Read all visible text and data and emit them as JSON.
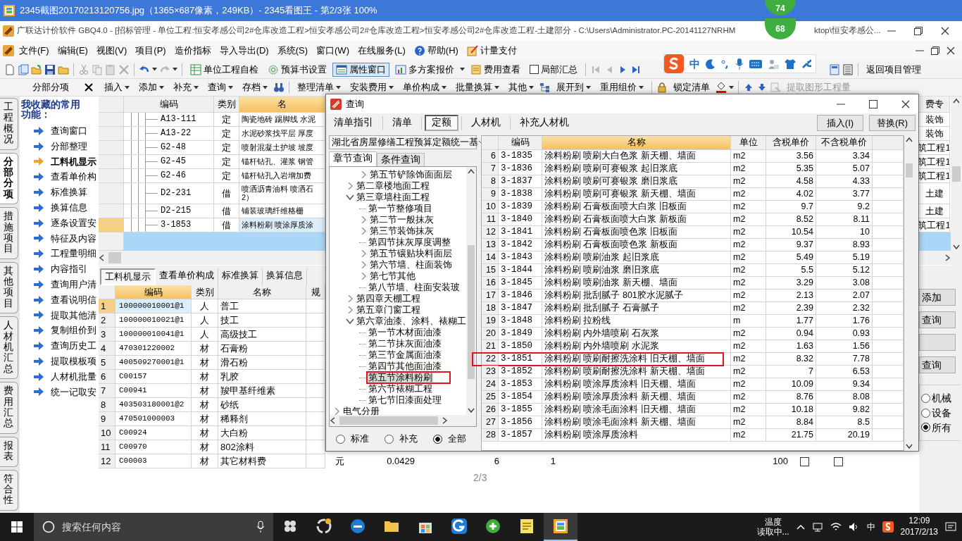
{
  "viewer": {
    "title": "2345截图20170213120756.jpg（1365×687像素，249KB）- 2345看图王 - 第2/3张 100%",
    "page_indicator": "2/3"
  },
  "speed_badges": [
    "74",
    "68"
  ],
  "app": {
    "title_start": "广联达计价软件 GBQ4.0 - [招标管理 - 单位工程:恒安孝感公司2#仓库改造工程>恒安孝感公司2#仓库改造工程>恒安孝感公司2#仓库改造工程-土建部分 - C:\\Users\\Administrator.PC-20141127NRHM",
    "title_end": "ktop\\恒安孝感公..."
  },
  "menu": [
    "文件(F)",
    "编辑(E)",
    "视图(V)",
    "项目(P)",
    "造价指标",
    "导入导出(D)",
    "系统(S)",
    "窗口(W)",
    "在线服务(L)",
    "帮助(H)",
    "计量支付"
  ],
  "toolbar1": [
    {
      "label": "单位工程自检",
      "pressed": false
    },
    {
      "label": "预算书设置",
      "pressed": false
    },
    {
      "label": "属性窗口",
      "pressed": true
    },
    {
      "label": "多方案报价",
      "pressed": false
    },
    {
      "label": "费用查看",
      "pressed": false
    }
  ],
  "local_summary": {
    "label": "局部汇总",
    "checked": false
  },
  "return_button": "返回项目管理",
  "ime_bar": {
    "mode": "中"
  },
  "panel_title": "分部分项",
  "toolbar2": [
    {
      "label": "插入",
      "dropdown": true,
      "disabled": false
    },
    {
      "label": "添加",
      "dropdown": true,
      "disabled": false
    },
    {
      "label": "补充",
      "dropdown": true,
      "disabled": false
    },
    {
      "label": "查询",
      "dropdown": true,
      "disabled": false
    },
    {
      "label": "存档",
      "dropdown": true,
      "disabled": false
    },
    {
      "label": "整理清单",
      "dropdown": true,
      "disabled": false
    },
    {
      "label": "安装费用",
      "dropdown": true,
      "disabled": false
    },
    {
      "label": "单价构成",
      "dropdown": true,
      "disabled": false
    },
    {
      "label": "批量换算",
      "dropdown": true,
      "disabled": false
    },
    {
      "label": "其他",
      "dropdown": true,
      "disabled": false
    },
    {
      "label": "展开到",
      "dropdown": true,
      "disabled": false
    },
    {
      "label": "重用组价",
      "dropdown": true,
      "disabled": false
    },
    {
      "label": "锁定清单",
      "dropdown": false,
      "disabled": false
    },
    {
      "label": "提取图形工程量",
      "dropdown": false,
      "disabled": true
    }
  ],
  "side_tabs": [
    {
      "label": "工程概况",
      "selected": false
    },
    {
      "label": "分部分项",
      "selected": true
    },
    {
      "label": "措施项目",
      "selected": false
    },
    {
      "label": "其他项目",
      "selected": false
    },
    {
      "label": "人材机汇总",
      "selected": false
    },
    {
      "label": "费用汇总",
      "selected": false
    },
    {
      "label": "报表",
      "selected": false
    },
    {
      "label": "符合性",
      "selected": false
    }
  ],
  "favorites": {
    "title": "我收藏的常用功能：",
    "items": [
      {
        "label": "查询窗口",
        "selected": false
      },
      {
        "label": "分部整理",
        "selected": false
      },
      {
        "label": "工料机显示",
        "selected": true
      },
      {
        "label": "查看单价构",
        "selected": false
      },
      {
        "label": "标准换算",
        "selected": false
      },
      {
        "label": "换算信息",
        "selected": false
      },
      {
        "label": "逐条设置安",
        "selected": false
      },
      {
        "label": "特征及内容",
        "selected": false
      },
      {
        "label": "工程量明细",
        "selected": false
      },
      {
        "label": "内容指引",
        "selected": false
      },
      {
        "label": "查询用户清",
        "selected": false
      },
      {
        "label": "查看说明信",
        "selected": false
      },
      {
        "label": "提取其他清",
        "selected": false
      },
      {
        "label": "复制组价到",
        "selected": false
      },
      {
        "label": "查询历史工",
        "selected": false
      },
      {
        "label": "提取模板项",
        "selected": false
      },
      {
        "label": "人材机批量",
        "selected": false
      },
      {
        "label": "统一记取安",
        "selected": false
      }
    ]
  },
  "upper_grid": {
    "columns": [
      "编码",
      "类别",
      "名"
    ],
    "slice_column": "费专",
    "rows": [
      {
        "code": "A13-111",
        "type": "定",
        "name": "陶瓷地砖 踢脚线 水泥",
        "slice": "装饰",
        "selected": false
      },
      {
        "code": "A13-22",
        "type": "定",
        "name": "水泥砂浆找平层 厚度",
        "slice": "装饰",
        "selected": false
      },
      {
        "code": "G2-48",
        "type": "定",
        "name": "喷射混凝土护坡 坡度",
        "slice": "筑工程1",
        "selected": false
      },
      {
        "code": "G2-45",
        "type": "定",
        "name": "锚杆钻孔、灌浆 钢管",
        "slice": "筑工程1",
        "selected": false
      },
      {
        "code": "G2-46",
        "type": "定",
        "name": "锚杆钻孔入岩增加费",
        "slice": "筑工程1",
        "selected": false
      },
      {
        "code": "D2-231",
        "type": "借",
        "name": "喷洒沥青油料 喷洒石\n2）",
        "slice": "土建",
        "selected": false
      },
      {
        "code": "D2-215",
        "type": "借",
        "name": "铺装玻璃纤维格栅",
        "slice": "土建",
        "selected": false
      },
      {
        "code": "3-1853",
        "type": "借",
        "name": "涂料粉刷 喷涂厚质涂",
        "slice": "筑工程1",
        "selected": true
      }
    ]
  },
  "lower_tabs": [
    {
      "label": "工料机显示",
      "selected": true
    },
    {
      "label": "查看单价构成",
      "selected": false
    },
    {
      "label": "标准换算",
      "selected": false
    },
    {
      "label": "换算信息",
      "selected": false
    }
  ],
  "lower_grid": {
    "columns": [
      "编码",
      "类别",
      "名称",
      "规"
    ],
    "rows": [
      {
        "no": "1",
        "code": "100000010001@1",
        "type": "人",
        "name": "普工",
        "selected": true
      },
      {
        "no": "2",
        "code": "100000010021@1",
        "type": "人",
        "name": "技工",
        "selected": false
      },
      {
        "no": "3",
        "code": "100000010041@1",
        "type": "人",
        "name": "高级技工",
        "selected": false
      },
      {
        "no": "4",
        "code": "470301220002",
        "type": "材",
        "name": "石膏粉",
        "selected": false
      },
      {
        "no": "5",
        "code": "400509270001@1",
        "type": "材",
        "name": "滑石粉",
        "selected": false
      },
      {
        "no": "6",
        "code": "C00157",
        "type": "材",
        "name": "乳胶",
        "selected": false
      },
      {
        "no": "7",
        "code": "C00941",
        "type": "材",
        "name": "羧甲基纤维素",
        "selected": false
      },
      {
        "no": "8",
        "code": "403503180001@2",
        "type": "材",
        "name": "砂纸",
        "selected": false
      },
      {
        "no": "9",
        "code": "470501000003",
        "type": "材",
        "name": "稀释剂",
        "selected": false
      },
      {
        "no": "10",
        "code": "C00924",
        "type": "材",
        "name": "大白粉",
        "selected": false
      },
      {
        "no": "11",
        "code": "C00970",
        "type": "材",
        "name": "802涂料",
        "selected": false
      },
      {
        "no": "12",
        "code": "C00003",
        "type": "材",
        "name": "其它材料费",
        "selected": false,
        "tail": {
          "unit": "元",
          "values": [
            "0.0429",
            "6",
            "1",
            "100"
          ],
          "checks": [
            false,
            false
          ]
        }
      }
    ]
  },
  "side_buttons": [
    {
      "kind": "text",
      "label": "添加"
    },
    {
      "kind": "text",
      "label": "查询"
    },
    {
      "kind": "blank"
    },
    {
      "kind": "text",
      "label": "查询"
    }
  ],
  "side_radios": [
    {
      "label": "机械",
      "selected": false
    },
    {
      "label": "设备",
      "selected": false
    },
    {
      "label": "所有",
      "selected": true
    }
  ],
  "dialog": {
    "title": "查询",
    "tabs": [
      {
        "label": "清单指引",
        "selected": false
      },
      {
        "label": "清单",
        "selected": false
      },
      {
        "label": "定额",
        "selected": true
      },
      {
        "label": "人材机",
        "selected": false
      },
      {
        "label": "补充人材机",
        "selected": false
      }
    ],
    "buttons": [
      "插入(I)",
      "替换(R)"
    ],
    "library": "湖北省房屋修缮工程预算定额统一基",
    "subtabs": [
      {
        "label": "章节查询",
        "selected": true
      },
      {
        "label": "条件查询",
        "selected": false
      }
    ],
    "tree": [
      {
        "children": [
          {
            "children": [
              {
                "label": "第五节铲除饰面面层",
                "kind": "folder",
                "expanded": false,
                "selected": false,
                "marked": false
              }
            ]
          },
          {
            "label": "第二章楼地面工程",
            "kind": "folder",
            "expanded": false,
            "selected": false,
            "marked": false
          },
          {
            "label": "第三章墙柱面工程",
            "kind": "folder",
            "expanded": true,
            "selected": false,
            "marked": false,
            "children": [
              {
                "label": "第一节整修项目",
                "kind": "leaf",
                "selected": false,
                "marked": false
              },
              {
                "label": "第二节一般抹灰",
                "kind": "folder",
                "expanded": false,
                "selected": false,
                "marked": false
              },
              {
                "label": "第三节装饰抹灰",
                "kind": "folder",
                "expanded": false,
                "selected": false,
                "marked": false
              },
              {
                "label": "第四节抹灰厚度调整",
                "kind": "leaf",
                "selected": false,
                "marked": false
              },
              {
                "label": "第五节镶贴块料面层",
                "kind": "folder",
                "expanded": false,
                "selected": false,
                "marked": false
              },
              {
                "label": "第六节墙、柱面装饰",
                "kind": "folder",
                "expanded": false,
                "selected": false,
                "marked": false
              },
              {
                "label": "第七节其他",
                "kind": "folder",
                "expanded": false,
                "selected": false,
                "marked": false
              },
              {
                "label": "第八节墙、柱面安装玻",
                "kind": "leaf",
                "selected": false,
                "marked": false
              }
            ]
          },
          {
            "label": "第四章天棚工程",
            "kind": "folder",
            "expanded": false,
            "selected": false,
            "marked": false
          },
          {
            "label": "第五章门窗工程",
            "kind": "folder",
            "expanded": false,
            "selected": false,
            "marked": false
          },
          {
            "label": "第六章油漆、涂料、裱糊工",
            "kind": "folder",
            "expanded": true,
            "selected": false,
            "marked": false,
            "children": [
              {
                "label": "第一节木材面油漆",
                "kind": "leaf",
                "selected": false,
                "marked": false
              },
              {
                "label": "第二节抹灰面油漆",
                "kind": "leaf",
                "selected": false,
                "marked": false
              },
              {
                "label": "第三节金属面油漆",
                "kind": "leaf",
                "selected": false,
                "marked": false
              },
              {
                "label": "第四节其他面油漆",
                "kind": "leaf",
                "selected": false,
                "marked": false
              },
              {
                "label": "第五节涂料粉刷",
                "kind": "leaf",
                "selected": true,
                "marked": true
              },
              {
                "label": "第六节裱糊工程",
                "kind": "leaf",
                "selected": false,
                "marked": false
              },
              {
                "label": "第七节旧漆面处理",
                "kind": "leaf",
                "selected": false,
                "marked": false
              }
            ]
          }
        ]
      },
      {
        "label": "电气分册",
        "kind": "folder",
        "expanded": false,
        "selected": false,
        "marked": false
      }
    ],
    "scope": [
      {
        "label": "标准",
        "selected": false
      },
      {
        "label": "补充",
        "selected": false
      },
      {
        "label": "全部",
        "selected": true
      }
    ],
    "table": {
      "columns": [
        "编码",
        "名称",
        "单位",
        "含税单价",
        "不含税单价"
      ],
      "rows": [
        {
          "no": "6",
          "code": "3-1835",
          "name": "涂料粉刷 喷刷大白色浆 新天棚、墙面",
          "unit": "m2",
          "price_tax": "3.56",
          "price_net": "3.34",
          "marked": false
        },
        {
          "no": "7",
          "code": "3-1836",
          "name": "涂料粉刷 喷刷可赛银浆 起旧浆底",
          "unit": "m2",
          "price_tax": "5.35",
          "price_net": "5.07",
          "marked": false
        },
        {
          "no": "8",
          "code": "3-1837",
          "name": "涂料粉刷 喷刷可赛银浆 磨旧浆底",
          "unit": "m2",
          "price_tax": "4.58",
          "price_net": "4.33",
          "marked": false
        },
        {
          "no": "9",
          "code": "3-1838",
          "name": "涂料粉刷 喷刷可赛银浆 新天棚、墙面",
          "unit": "m2",
          "price_tax": "4.02",
          "price_net": "3.77",
          "marked": false
        },
        {
          "no": "10",
          "code": "3-1839",
          "name": "涂料粉刷 石膏板面喷大白浆 旧板面",
          "unit": "m2",
          "price_tax": "9.7",
          "price_net": "9.2",
          "marked": false
        },
        {
          "no": "11",
          "code": "3-1840",
          "name": "涂料粉刷 石膏板面喷大白浆 新板面",
          "unit": "m2",
          "price_tax": "8.52",
          "price_net": "8.11",
          "marked": false
        },
        {
          "no": "12",
          "code": "3-1841",
          "name": "涂料粉刷 石膏板面喷色浆 旧板面",
          "unit": "m2",
          "price_tax": "10.54",
          "price_net": "10",
          "marked": false
        },
        {
          "no": "13",
          "code": "3-1842",
          "name": "涂料粉刷 石膏板面喷色浆 新板面",
          "unit": "m2",
          "price_tax": "9.37",
          "price_net": "8.93",
          "marked": false
        },
        {
          "no": "14",
          "code": "3-1843",
          "name": "涂料粉刷 喷刷油浆 起旧浆底",
          "unit": "m2",
          "price_tax": "5.49",
          "price_net": "5.19",
          "marked": false
        },
        {
          "no": "15",
          "code": "3-1844",
          "name": "涂料粉刷 喷刷油浆 磨旧浆底",
          "unit": "m2",
          "price_tax": "5.5",
          "price_net": "5.12",
          "marked": false
        },
        {
          "no": "16",
          "code": "3-1845",
          "name": "涂料粉刷 喷刷油浆 新天棚、墙面",
          "unit": "m2",
          "price_tax": "3.29",
          "price_net": "3.08",
          "marked": false
        },
        {
          "no": "17",
          "code": "3-1846",
          "name": "涂料粉刷 批刮腻子 801胶水泥腻子",
          "unit": "m2",
          "price_tax": "2.13",
          "price_net": "2.07",
          "marked": false
        },
        {
          "no": "18",
          "code": "3-1847",
          "name": "涂料粉刷 批刮腻子 石膏腻子",
          "unit": "m2",
          "price_tax": "2.39",
          "price_net": "2.32",
          "marked": false
        },
        {
          "no": "19",
          "code": "3-1848",
          "name": "涂料粉刷 拉粉线",
          "unit": "m",
          "price_tax": "1.77",
          "price_net": "1.76",
          "marked": false
        },
        {
          "no": "20",
          "code": "3-1849",
          "name": "涂料粉刷 内外墙喷刷 石灰浆",
          "unit": "m2",
          "price_tax": "0.94",
          "price_net": "0.93",
          "marked": false
        },
        {
          "no": "21",
          "code": "3-1850",
          "name": "涂料粉刷 内外墙喷刷 水泥浆",
          "unit": "m2",
          "price_tax": "1.63",
          "price_net": "1.56",
          "marked": false
        },
        {
          "no": "22",
          "code": "3-1851",
          "name": "涂料粉刷 喷刷耐擦洗涂料 旧天棚、墙面",
          "unit": "m2",
          "price_tax": "8.32",
          "price_net": "7.78",
          "marked": true
        },
        {
          "no": "23",
          "code": "3-1852",
          "name": "涂料粉刷 喷刷耐擦洗涂料 新天棚、墙面",
          "unit": "m2",
          "price_tax": "7",
          "price_net": "6.53",
          "marked": false
        },
        {
          "no": "24",
          "code": "3-1853",
          "name": "涂料粉刷 喷涂厚质涂料 旧天棚、墙面",
          "unit": "m2",
          "price_tax": "10.09",
          "price_net": "9.34",
          "marked": false
        },
        {
          "no": "25",
          "code": "3-1854",
          "name": "涂料粉刷 喷涂厚质涂料 新天棚、墙面",
          "unit": "m2",
          "price_tax": "8.76",
          "price_net": "8.08",
          "marked": false
        },
        {
          "no": "26",
          "code": "3-1855",
          "name": "涂料粉刷 喷涂毛面涂料 旧天棚、墙面",
          "unit": "m2",
          "price_tax": "10.18",
          "price_net": "9.82",
          "marked": false
        },
        {
          "no": "27",
          "code": "3-1856",
          "name": "涂料粉刷 喷涂毛面涂料 新天棚、墙面",
          "unit": "m2",
          "price_tax": "8.84",
          "price_net": "8.5",
          "marked": false
        },
        {
          "no": "28",
          "code": "3-1857",
          "name": "涂料粉刷 喷涂厚质涂料",
          "unit": "m2",
          "price_tax": "21.75",
          "price_net": "20.19",
          "marked": false
        }
      ]
    }
  },
  "taskbar": {
    "search_placeholder": "搜索任何内容",
    "apps": [
      {
        "selected": false
      },
      {
        "selected": false
      },
      {
        "selected": false
      },
      {
        "selected": false
      },
      {
        "selected": false
      },
      {
        "selected": false
      },
      {
        "selected": false
      },
      {
        "selected": false
      },
      {
        "selected": true
      }
    ],
    "weather": [
      "温度",
      "读取中..."
    ],
    "ime": "中",
    "time": "12:09",
    "date": "2017/2/13"
  }
}
